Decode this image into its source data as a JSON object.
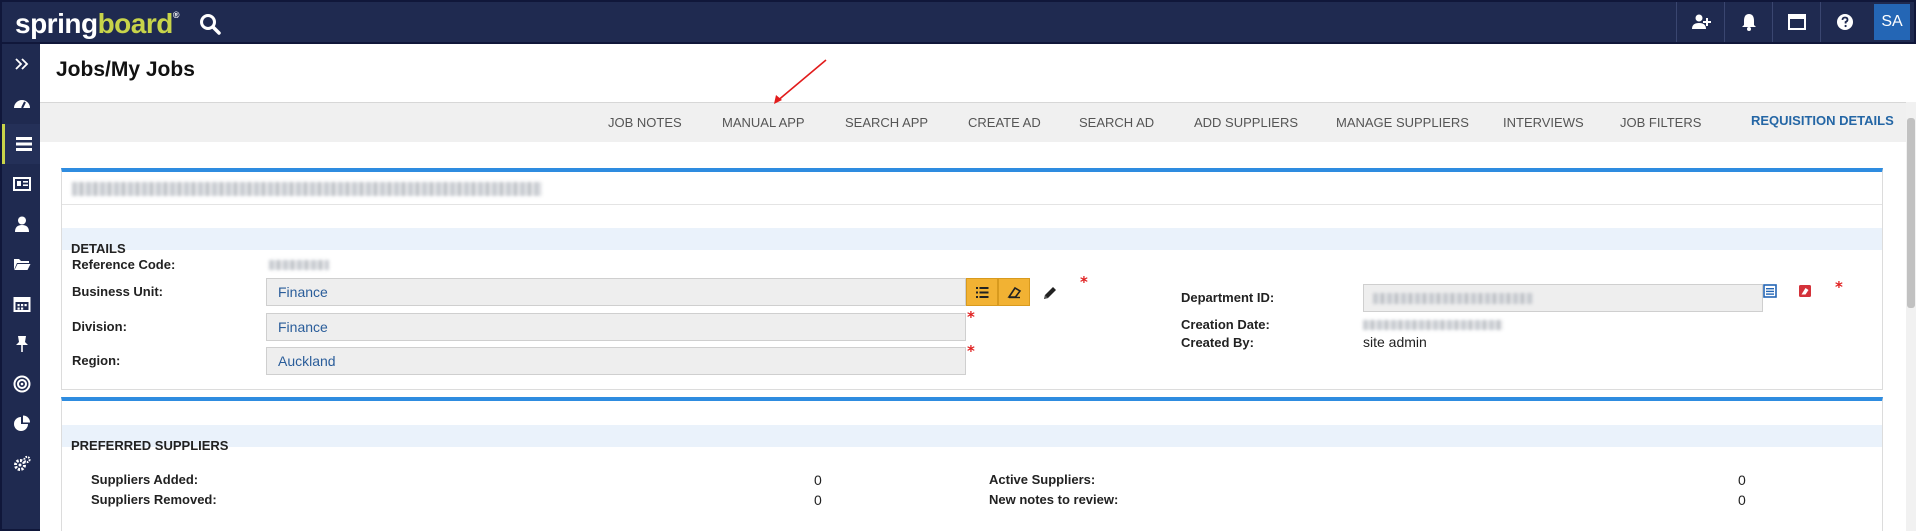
{
  "app": {
    "logo_main": "spring",
    "logo_accent": "board",
    "logo_mark": "®"
  },
  "header": {
    "avatar_initials": "SA"
  },
  "page": {
    "title": "Jobs/My Jobs"
  },
  "tabs": [
    {
      "label": "JOB NOTES"
    },
    {
      "label": "MANUAL APP"
    },
    {
      "label": "SEARCH APP"
    },
    {
      "label": "CREATE AD"
    },
    {
      "label": "SEARCH AD"
    },
    {
      "label": "ADD SUPPLIERS"
    },
    {
      "label": "MANAGE SUPPLIERS"
    },
    {
      "label": "INTERVIEWS"
    },
    {
      "label": "JOB FILTERS"
    },
    {
      "label": "REQUISITION DETAILS",
      "active": true
    }
  ],
  "details": {
    "section_title": "DETAILS",
    "reference_code_label": "Reference Code:",
    "business_unit_label": "Business Unit:",
    "business_unit_value": "Finance",
    "division_label": "Division:",
    "division_value": "Finance",
    "region_label": "Region:",
    "region_value": "Auckland",
    "department_id_label": "Department ID:",
    "creation_date_label": "Creation Date:",
    "created_by_label": "Created By:",
    "created_by_value": "site admin",
    "required_mark": "*"
  },
  "preferred_suppliers": {
    "section_title": "PREFERRED SUPPLIERS",
    "suppliers_added_label": "Suppliers Added:",
    "suppliers_added_value": "0",
    "suppliers_removed_label": "Suppliers Removed:",
    "suppliers_removed_value": "0",
    "active_suppliers_label": "Active Suppliers:",
    "active_suppliers_value": "0",
    "new_notes_label": "New notes to review:",
    "new_notes_value": "0"
  },
  "colors": {
    "nav_bg": "#1f2a50",
    "accent_blue": "#2e8ce0",
    "tab_active": "#2466a5",
    "logo_green": "#c8d44a",
    "amber": "#f2b233",
    "required": "#e02020"
  }
}
